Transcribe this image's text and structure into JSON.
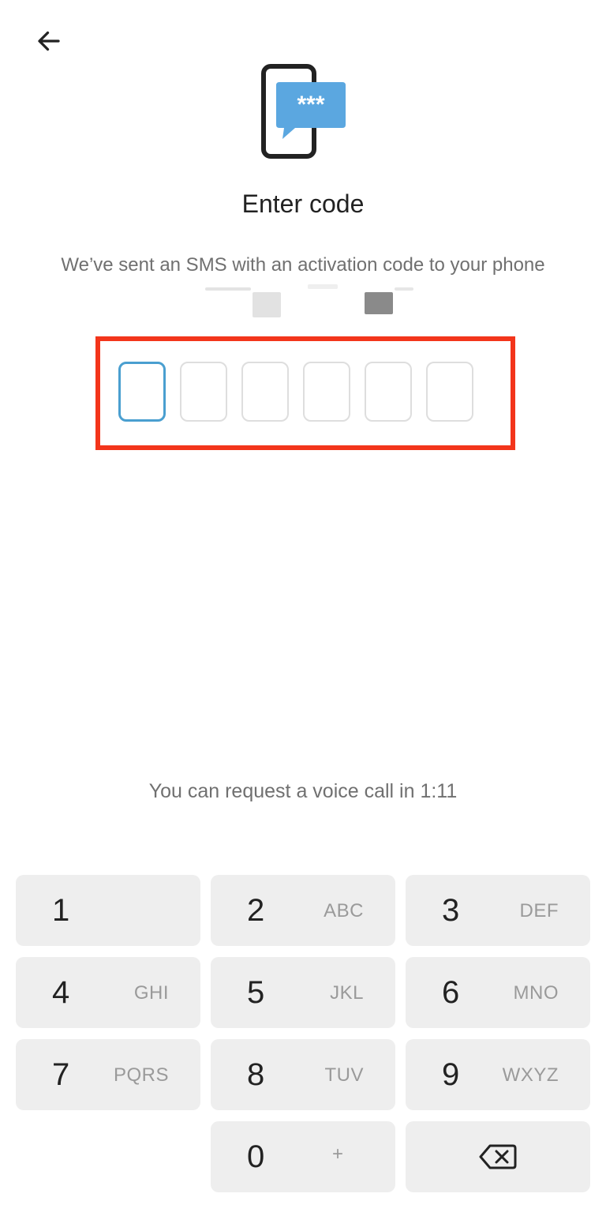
{
  "header": {
    "back_icon": "arrow-left-icon",
    "hero_icon": "phone-sms-code-icon",
    "hero_bubble_text": "***",
    "title": "Enter code",
    "subtitle": "We’ve sent an SMS with an activation code to your phone"
  },
  "code_input": {
    "cells": [
      "",
      "",
      "",
      "",
      "",
      ""
    ],
    "active_index": 0,
    "colors": {
      "active_border": "#4a9fd0",
      "inactive_border": "#dedede",
      "highlight_frame": "#f3351b"
    }
  },
  "status": {
    "voice_call_text": "You can request a voice call in 1:11"
  },
  "keypad": {
    "keys": [
      {
        "digit": "1",
        "letters": ""
      },
      {
        "digit": "2",
        "letters": "ABC"
      },
      {
        "digit": "3",
        "letters": "DEF"
      },
      {
        "digit": "4",
        "letters": "GHI"
      },
      {
        "digit": "5",
        "letters": "JKL"
      },
      {
        "digit": "6",
        "letters": "MNO"
      },
      {
        "digit": "7",
        "letters": "PQRS"
      },
      {
        "digit": "8",
        "letters": "TUV"
      },
      {
        "digit": "9",
        "letters": "WXYZ"
      },
      {
        "digit": "0",
        "letters": "+"
      }
    ],
    "backspace_icon": "backspace-icon"
  }
}
